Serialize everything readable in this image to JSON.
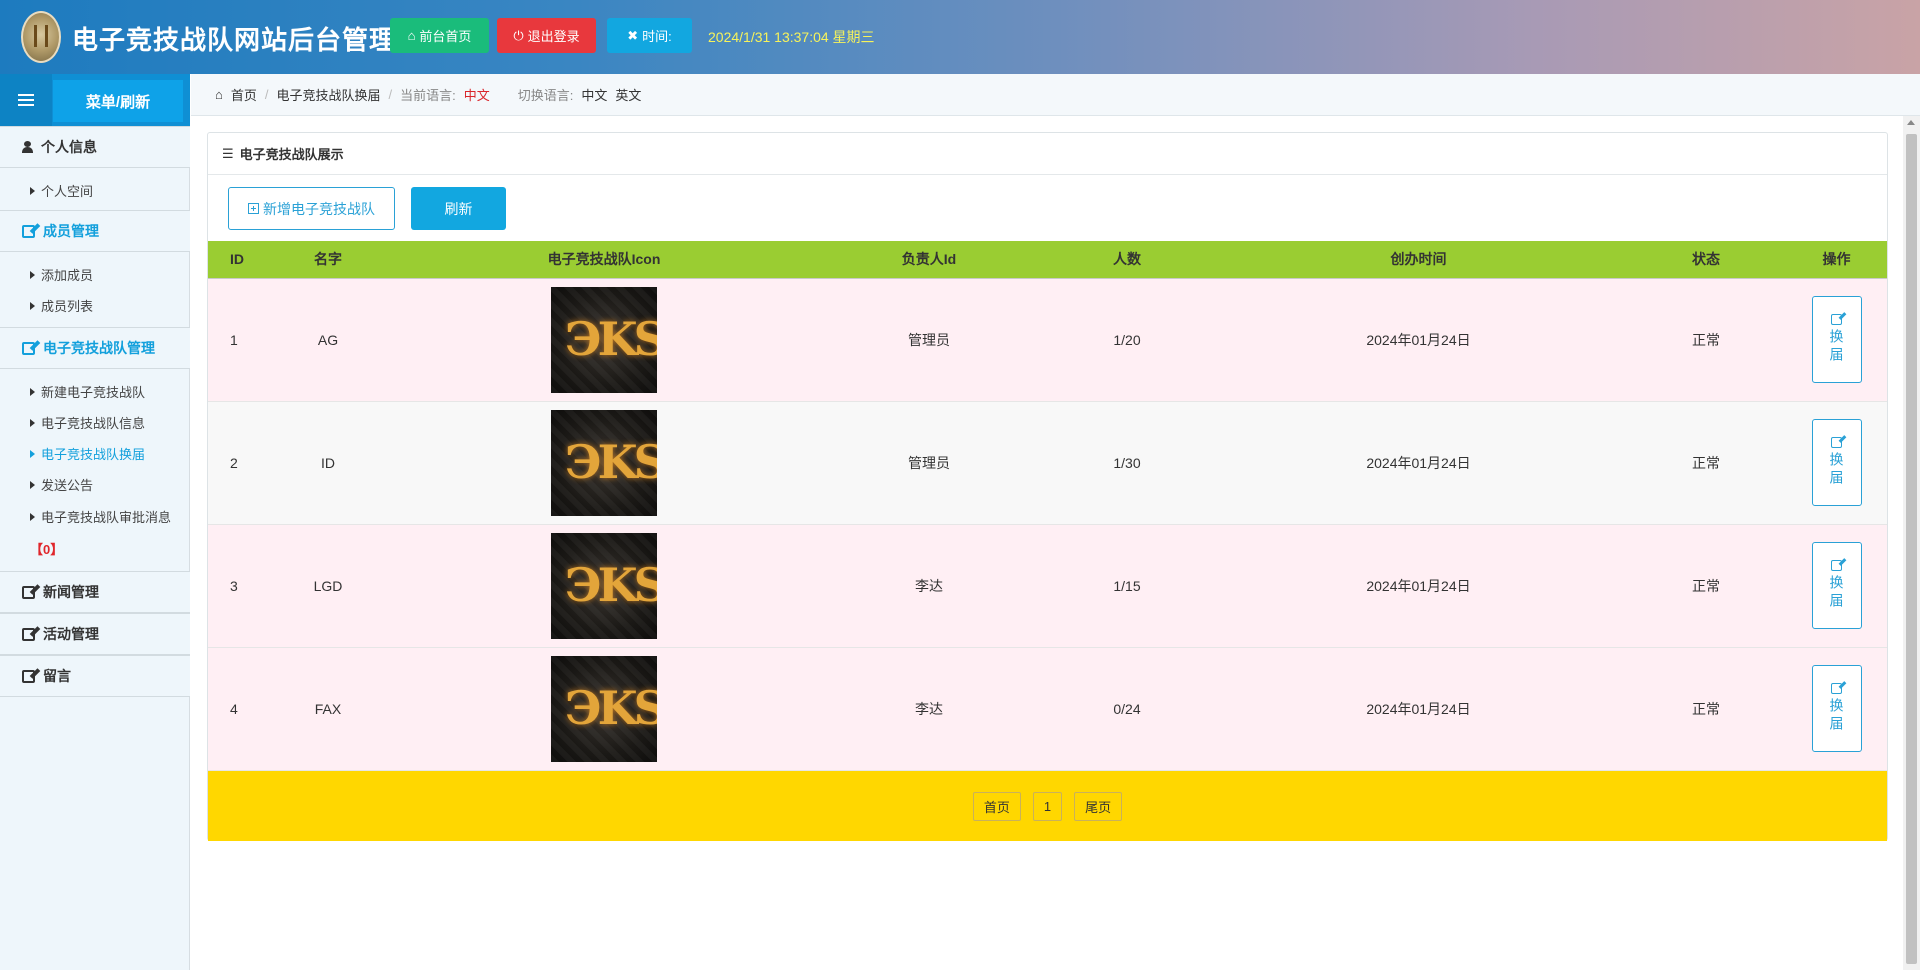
{
  "header": {
    "site_title": "电子竞技战队网站后台管理",
    "home_button": "前台首页",
    "logout_button": "退出登录",
    "time_button": "时间:",
    "clock_text": "2024/1/31 13:37:04 星期三"
  },
  "sidebar": {
    "menu_refresh": "菜单/刷新",
    "sections": [
      {
        "label": "个人信息"
      },
      {
        "label": "成员管理"
      },
      {
        "label": "电子竞技战队管理"
      },
      {
        "label": "新闻管理"
      },
      {
        "label": "活动管理"
      },
      {
        "label": "留言"
      }
    ],
    "items": [
      {
        "label": "个人空间"
      },
      {
        "label": "添加成员"
      },
      {
        "label": "成员列表"
      },
      {
        "label": "新建电子竞技战队"
      },
      {
        "label": "电子竞技战队信息"
      },
      {
        "label": "电子竞技战队换届"
      },
      {
        "label": "发送公告"
      },
      {
        "label": "电子竞技战队审批消息"
      }
    ],
    "approval_count": "【0】"
  },
  "breadcrumb": {
    "home": "首页",
    "current": "电子竞技战队换届",
    "lang_label": "当前语言:",
    "lang_value": "中文",
    "switch_label": "切换语言:",
    "switch_cn": "中文",
    "switch_en": "英文"
  },
  "panel": {
    "title": "电子竞技战队展示",
    "add_button": "新增电子竞技战队",
    "refresh_button": "刷新"
  },
  "table": {
    "headers": [
      "ID",
      "名字",
      "电子竞技战队Icon",
      "负责人Id",
      "人数",
      "创办时间",
      "状态",
      "操作"
    ],
    "rows": [
      {
        "id": "1",
        "name": "AG",
        "leader": "管理员",
        "members": "1/20",
        "founded": "2024年01月24日",
        "status": "正常",
        "action": "换届"
      },
      {
        "id": "2",
        "name": "ID",
        "leader": "管理员",
        "members": "1/30",
        "founded": "2024年01月24日",
        "status": "正常",
        "action": "换届"
      },
      {
        "id": "3",
        "name": "LGD",
        "leader": "李达",
        "members": "1/15",
        "founded": "2024年01月24日",
        "status": "正常",
        "action": "换届"
      },
      {
        "id": "4",
        "name": "FAX",
        "leader": "李达",
        "members": "0/24",
        "founded": "2024年01月24日",
        "status": "正常",
        "action": "换届"
      }
    ]
  },
  "pager": {
    "first": "首页",
    "page": "1",
    "last": "尾页"
  },
  "colors": {
    "header_start": "#1d7bbf",
    "table_header": "#9acd32",
    "pager_bg": "#ffd700",
    "accent": "#12a7e0"
  }
}
